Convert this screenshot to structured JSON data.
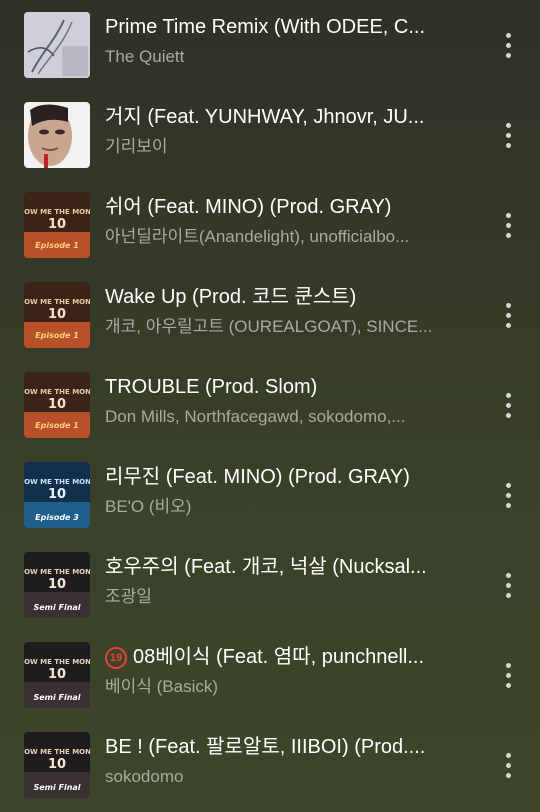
{
  "tracks": [
    {
      "title": "Prime Time Remix (With ODEE, C...",
      "artist": "The Quiett",
      "explicit": false,
      "cover_icon": "prime-time-cover-icon"
    },
    {
      "title": "거지 (Feat. YUNHWAY, Jhnovr, JU...",
      "artist": "기리보이",
      "explicit": false,
      "cover_icon": "portrait-cover-icon"
    },
    {
      "title": "쉬어 (Feat. MINO) (Prod. GRAY)",
      "artist": "아넌딜라이트(Anandelight), unofficialbo...",
      "explicit": false,
      "cover_icon": "smtm10-episode1-cover-icon"
    },
    {
      "title": "Wake Up (Prod. 코드 쿤스트)",
      "artist": "개코, 아우릴고트 (OUREALGOAT), SINCE...",
      "explicit": false,
      "cover_icon": "smtm10-episode1-cover-icon"
    },
    {
      "title": "TROUBLE (Prod. Slom)",
      "artist": "Don Mills, Northfacegawd, sokodomo,...",
      "explicit": false,
      "cover_icon": "smtm10-episode1-cover-icon"
    },
    {
      "title": "리무진 (Feat. MINO) (Prod. GRAY)",
      "artist": "BE'O (비오)",
      "explicit": false,
      "cover_icon": "smtm10-episode3-cover-icon"
    },
    {
      "title": "호우주의 (Feat. 개코, 넉살 (Nucksal...",
      "artist": "조광일",
      "explicit": false,
      "cover_icon": "smtm10-semifinal-cover-icon"
    },
    {
      "title": "08베이식 (Feat. 염따, punchnell...",
      "artist": "베이식 (Basick)",
      "explicit": true,
      "badge": "19",
      "cover_icon": "smtm10-semifinal-cover-icon"
    },
    {
      "title": "BE ! (Feat. 팔로알토, IIIBOI) (Prod....",
      "artist": "sokodomo",
      "explicit": false,
      "cover_icon": "smtm10-semifinal-cover-icon"
    }
  ],
  "cover_text": {
    "smtm": "SHOW ME THE MONEY",
    "number": "10",
    "episode1": "Episode 1",
    "episode3": "Episode 3",
    "semifinal": "Semi Final"
  },
  "colors": {
    "title": "#ffffff",
    "artist": "#a9ac9d",
    "explicit_badge": "#e8423b"
  }
}
